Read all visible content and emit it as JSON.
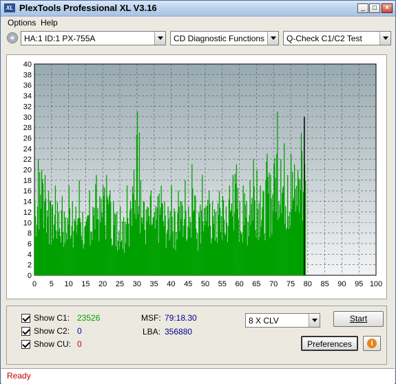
{
  "window": {
    "title": "PlexTools Professional XL V3.16",
    "icon_text": "XL"
  },
  "menu": {
    "items": [
      "Options",
      "Help"
    ]
  },
  "toolbar": {
    "drive": "HA:1 ID:1  PX-755A",
    "function": "CD Diagnostic Functions",
    "test": "Q-Check C1/C2 Test"
  },
  "chart_data": {
    "type": "bar",
    "xlim": [
      0,
      100
    ],
    "ylim": [
      0,
      40
    ],
    "x_ticks": [
      0,
      5,
      10,
      15,
      20,
      25,
      30,
      35,
      40,
      45,
      50,
      55,
      60,
      65,
      70,
      75,
      80,
      85,
      90,
      95,
      100
    ],
    "y_ticks": [
      0,
      2,
      4,
      6,
      8,
      10,
      12,
      14,
      16,
      18,
      20,
      22,
      24,
      26,
      28,
      30,
      32,
      34,
      36,
      38,
      40
    ],
    "grid": true,
    "data_extent": 79.3,
    "series": [
      {
        "key": "c1",
        "color": "#00a000",
        "x": [
          0,
          1,
          2,
          2.5,
          3,
          4,
          5,
          6,
          7,
          8,
          9,
          10,
          11,
          12,
          13,
          14,
          15,
          16,
          17,
          18,
          19,
          20,
          21,
          22,
          23,
          24,
          25,
          26,
          27,
          28,
          29,
          30,
          30.5,
          31,
          32,
          33,
          34,
          35,
          36,
          37,
          38,
          39,
          40,
          41,
          42,
          43,
          44,
          45,
          46,
          47,
          48,
          49,
          50,
          51,
          52,
          53,
          54,
          55,
          56,
          57,
          58,
          59,
          60,
          61,
          62,
          63,
          64,
          65,
          66,
          67,
          68,
          69,
          70,
          71,
          72,
          73,
          74,
          75,
          76,
          77,
          78,
          79
        ],
        "y": [
          14,
          22,
          20,
          23,
          19,
          16,
          13,
          17,
          12,
          15,
          11,
          17,
          14,
          13,
          18,
          12,
          10,
          16,
          13,
          19,
          15,
          17,
          19,
          16,
          14,
          12,
          13,
          11,
          17,
          14,
          20,
          31,
          27,
          18,
          14,
          13,
          16,
          12,
          15,
          17,
          14,
          13,
          17,
          12,
          16,
          14,
          18,
          13,
          21,
          15,
          12,
          19,
          13,
          16,
          14,
          12,
          16,
          15,
          13,
          17,
          19,
          21,
          14,
          17,
          14,
          18,
          22,
          20,
          17,
          16,
          23,
          19,
          21,
          31,
          22,
          25,
          19,
          23,
          21,
          20,
          27,
          21
        ]
      },
      {
        "key": "cu",
        "color": "#000000",
        "x": [
          79
        ],
        "y": [
          30
        ]
      }
    ]
  },
  "panel": {
    "show_c1": "Show C1:",
    "c1_value": "23526",
    "show_c2": "Show C2:",
    "c2_value": "0",
    "show_cu": "Show CU:",
    "cu_value": "0",
    "msf_label": "MSF:",
    "msf_value": "79:18.30",
    "lba_label": "LBA:",
    "lba_value": "356880",
    "speed": "8 X CLV",
    "start": "Start",
    "preferences": "Preferences",
    "colors": {
      "c1": "#00a000",
      "c2": "#0000cc",
      "cu": "#cc0000",
      "msf": "#00008b"
    }
  },
  "status": {
    "text": "Ready"
  }
}
